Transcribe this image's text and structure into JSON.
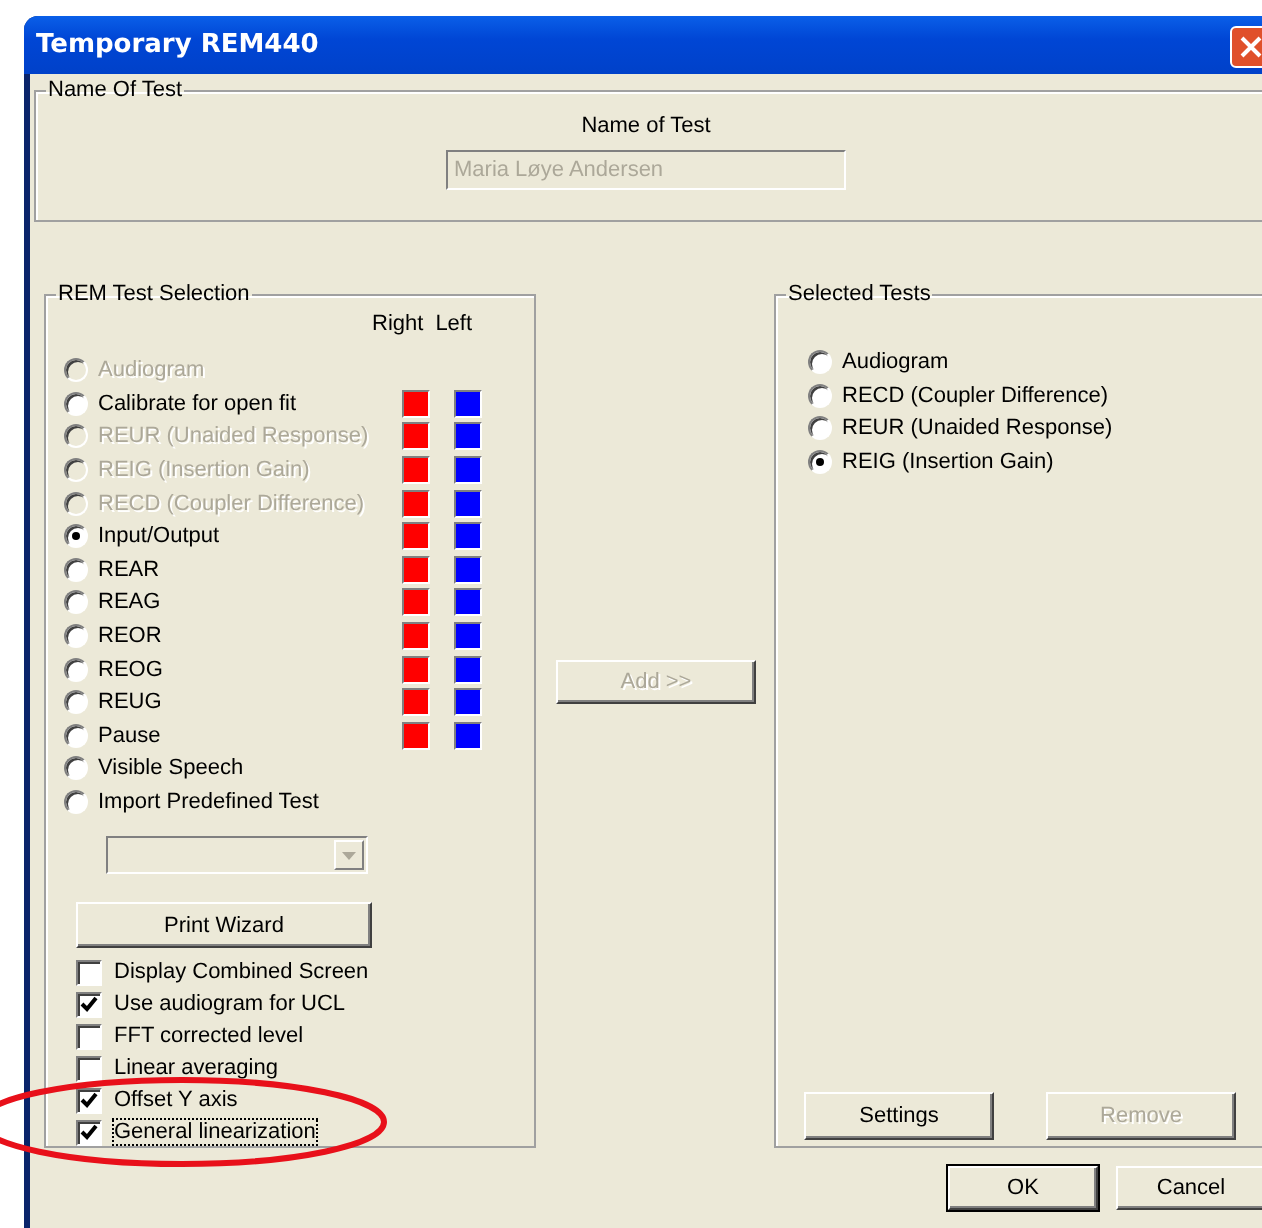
{
  "window": {
    "title": "Temporary REM440"
  },
  "name_group": {
    "title": "Name Of Test",
    "label": "Name of Test",
    "field": {
      "value": "Maria Løye Andersen",
      "disabled": true
    }
  },
  "rem_group": {
    "title": "REM Test Selection",
    "column_headers": [
      "Right",
      "Left"
    ],
    "tests": [
      {
        "label": "Audiogram",
        "selected": false,
        "disabled": true,
        "swatches": false
      },
      {
        "label": "Calibrate for open fit",
        "selected": false,
        "disabled": false,
        "swatches": true
      },
      {
        "label": "REUR (Unaided Response)",
        "selected": false,
        "disabled": true,
        "swatches": true
      },
      {
        "label": "REIG (Insertion Gain)",
        "selected": false,
        "disabled": true,
        "swatches": true
      },
      {
        "label": "RECD (Coupler Difference)",
        "selected": false,
        "disabled": true,
        "swatches": true
      },
      {
        "label": "Input/Output",
        "selected": true,
        "disabled": false,
        "swatches": true
      },
      {
        "label": "REAR",
        "selected": false,
        "disabled": false,
        "swatches": true
      },
      {
        "label": "REAG",
        "selected": false,
        "disabled": false,
        "swatches": true
      },
      {
        "label": "REOR",
        "selected": false,
        "disabled": false,
        "swatches": true
      },
      {
        "label": "REOG",
        "selected": false,
        "disabled": false,
        "swatches": true
      },
      {
        "label": "REUG",
        "selected": false,
        "disabled": false,
        "swatches": true
      },
      {
        "label": "Pause",
        "selected": false,
        "disabled": false,
        "swatches": true
      },
      {
        "label": "Visible Speech",
        "selected": false,
        "disabled": false,
        "swatches": false
      },
      {
        "label": "Import Predefined Test",
        "selected": false,
        "disabled": false,
        "swatches": false
      }
    ],
    "dropdown": {
      "disabled": true
    },
    "print_button": {
      "label": "Print Wizard"
    },
    "options": [
      {
        "label": "Display Combined Screen",
        "checked": false,
        "focused": false
      },
      {
        "label": "Use audiogram for UCL",
        "checked": true,
        "focused": false
      },
      {
        "label": "FFT corrected level",
        "checked": false,
        "focused": false
      },
      {
        "label": "Linear averaging",
        "checked": false,
        "focused": false
      },
      {
        "label": "Offset Y axis",
        "checked": true,
        "focused": false
      },
      {
        "label": "General linearization",
        "checked": true,
        "focused": true
      }
    ]
  },
  "add_button": {
    "label": "Add >>",
    "disabled": true
  },
  "selected_group": {
    "title": "Selected Tests",
    "tests": [
      {
        "label": "Audiogram",
        "selected": false
      },
      {
        "label": "RECD (Coupler Difference)",
        "selected": false
      },
      {
        "label": "REUR (Unaided Response)",
        "selected": false
      },
      {
        "label": "REIG (Insertion Gain)",
        "selected": true
      }
    ],
    "buttons": [
      {
        "label": "Settings",
        "disabled": false
      },
      {
        "label": "Remove",
        "disabled": true
      }
    ]
  },
  "dialog_buttons": [
    {
      "label": "OK",
      "default": true
    },
    {
      "label": "Cancel",
      "default": false
    }
  ]
}
